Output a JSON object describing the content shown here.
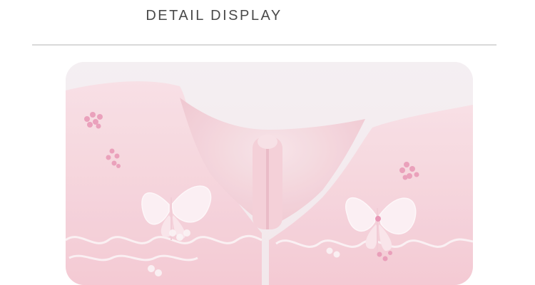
{
  "section": {
    "title": "DETAIL DISPLAY"
  },
  "photo": {
    "subject": "lace-collar-closeup-photo",
    "colors": {
      "background": "#f4eef1",
      "fabric": "#f6d2d9",
      "fabric_deep": "#efb9c6",
      "embroidery": "#fbf3f5",
      "sequin": "#e78fb0"
    }
  }
}
